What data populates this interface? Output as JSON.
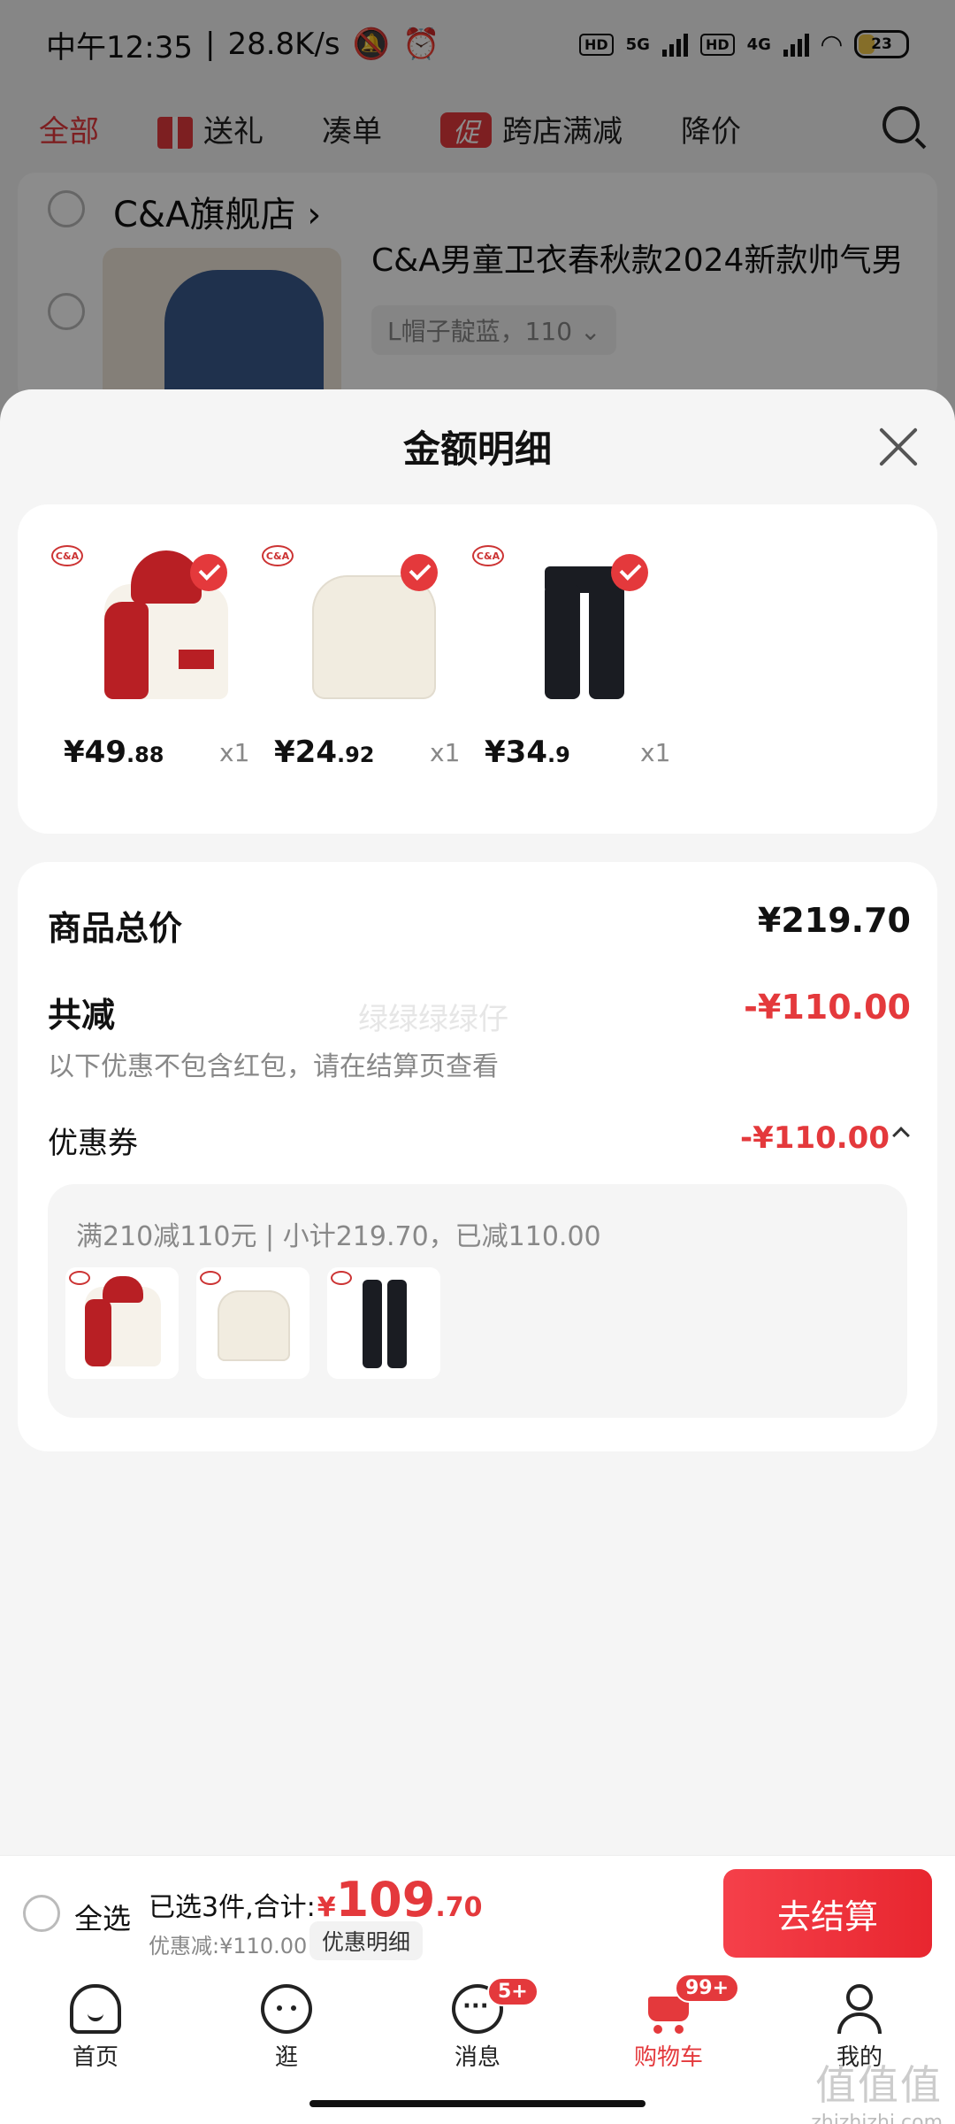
{
  "status_bar": {
    "time": "中午12:35",
    "speed": "28.8K/s",
    "hd1": "HD",
    "net1": "5G",
    "hd2": "HD",
    "net2": "4G",
    "battery": "23"
  },
  "filter_bar": {
    "tabs": [
      "全部",
      "送礼",
      "凑单",
      "跨店满减",
      "降价"
    ],
    "promo_tag": "促"
  },
  "background_shop": {
    "shop_name": "C&A旗舰店",
    "product_title": "C&A男童卫衣春秋款2024新款帅气男",
    "spec": "L帽子靛蓝，110"
  },
  "sheet": {
    "title": "金额明细",
    "items": [
      {
        "price_int": "¥49",
        "price_dec": ".88",
        "qty": "x1"
      },
      {
        "price_int": "¥24",
        "price_dec": ".92",
        "qty": "x1"
      },
      {
        "price_int": "¥34",
        "price_dec": ".9",
        "qty": "x1"
      }
    ],
    "total_label": "商品总价",
    "total_value": "¥219.70",
    "reduce_label": "共减",
    "reduce_value": "-¥110.00",
    "reduce_note": "以下优惠不包含红包，请在结算页查看",
    "watermark": "绿绿绿绿仔",
    "coupon_label": "优惠券",
    "coupon_value": "-¥110.00",
    "coupon_desc": "满210减110元 | 小计219.70，已减110.00"
  },
  "checkout": {
    "select_all": "全选",
    "selected_text": "已选3件,合计:",
    "currency": "¥",
    "total_int": "109",
    "total_dec": ".70",
    "discount_text": "优惠减:¥110.00",
    "detail_button": "优惠明细",
    "checkout_button": "去结算"
  },
  "tab_bar": {
    "tabs": [
      {
        "label": "首页"
      },
      {
        "label": "逛"
      },
      {
        "label": "消息",
        "badge": "5+"
      },
      {
        "label": "购物车",
        "badge": "99+"
      },
      {
        "label": "我的"
      }
    ]
  },
  "site_mark": {
    "big": "值值值",
    "small": "zhizhizhi.com"
  },
  "colors": {
    "accent": "#e4393c",
    "text": "#111111",
    "muted": "#888888"
  }
}
